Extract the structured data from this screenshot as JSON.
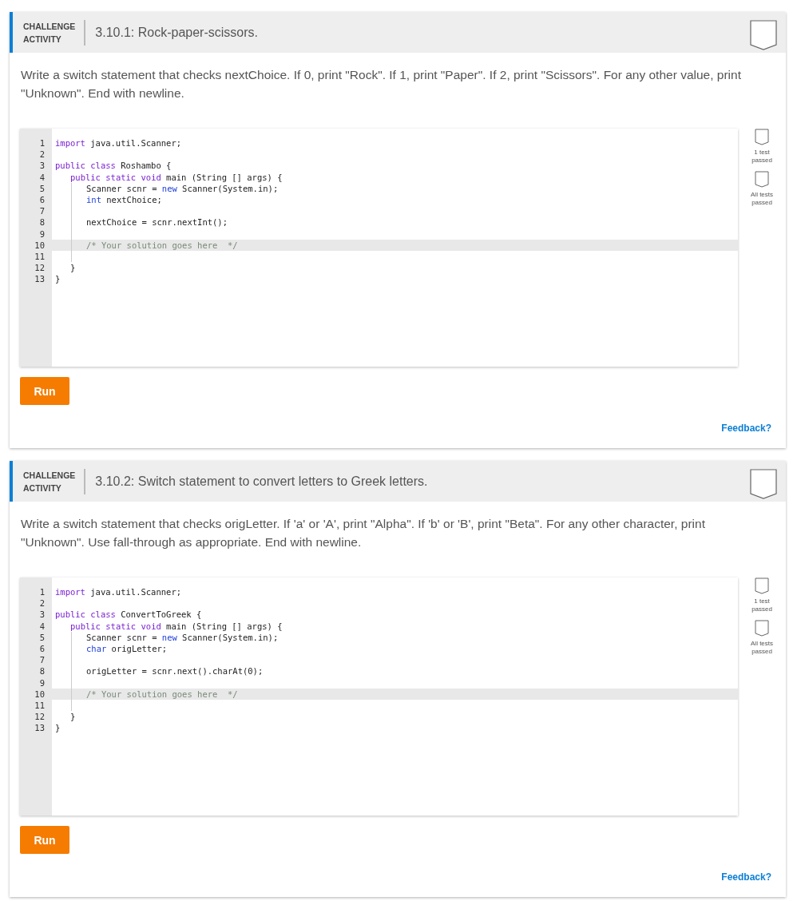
{
  "activities": [
    {
      "label_line1": "CHALLENGE",
      "label_line2": "ACTIVITY",
      "title": "3.10.1: Rock-paper-scissors.",
      "description": "Write a switch statement that checks nextChoice. If 0, print \"Rock\". If 1, print \"Paper\". If 2, print \"Scissors\". For any other value, print \"Unknown\". End with newline.",
      "code": [
        {
          "number": "1",
          "active": false,
          "tokens": [
            {
              "kind": "keyword",
              "text": "import"
            },
            {
              "kind": "plain",
              "text": " java.util.Scanner;"
            }
          ]
        },
        {
          "number": "2",
          "active": false
        },
        {
          "number": "3",
          "active": false,
          "tokens": [
            {
              "kind": "keyword",
              "text": "public class"
            },
            {
              "kind": "plain",
              "text": " Roshambo {"
            }
          ],
          "children": [
            {
              "number": "4",
              "active": false,
              "tokens": [
                {
                  "kind": "keyword",
                  "text": "public static void"
                },
                {
                  "kind": "plain",
                  "text": " main (String [] args) {"
                }
              ],
              "children": [
                {
                  "number": "5",
                  "active": false,
                  "tokens": [
                    {
                      "kind": "plain",
                      "text": "Scanner scnr = "
                    },
                    {
                      "kind": "type",
                      "text": "new"
                    },
                    {
                      "kind": "plain",
                      "text": " Scanner(System.in);"
                    }
                  ]
                },
                {
                  "number": "6",
                  "active": false,
                  "tokens": [
                    {
                      "kind": "type",
                      "text": "int"
                    },
                    {
                      "kind": "plain",
                      "text": " nextChoice;"
                    }
                  ]
                },
                {
                  "number": "7",
                  "active": false
                },
                {
                  "number": "8",
                  "active": false,
                  "tokens": [
                    {
                      "kind": "plain",
                      "text": "nextChoice = scnr.nextInt();"
                    }
                  ]
                },
                {
                  "number": "9",
                  "active": false
                },
                {
                  "number": "10",
                  "active": true,
                  "tokens": [
                    {
                      "kind": "comment",
                      "text": "/* Your solution goes here  */"
                    }
                  ]
                },
                {
                  "number": "11",
                  "active": false
                }
              ]
            },
            {
              "number": "12",
              "active": false,
              "tokens": [
                {
                  "kind": "plain",
                  "text": "}"
                }
              ]
            }
          ]
        },
        {
          "number": "13",
          "active": false,
          "tokens": [
            {
              "kind": "plain",
              "text": "}"
            }
          ]
        }
      ],
      "tests": [
        {
          "line1": "1 test",
          "line2": "passed"
        },
        {
          "line1": "All tests",
          "line2": "passed"
        }
      ],
      "run_button": "Run",
      "feedback": "Feedback?"
    },
    {
      "label_line1": "CHALLENGE",
      "label_line2": "ACTIVITY",
      "title": "3.10.2: Switch statement to convert letters to Greek letters.",
      "description": "Write a switch statement that checks origLetter. If 'a' or 'A', print \"Alpha\". If 'b' or 'B', print \"Beta\". For any other character, print \"Unknown\". Use fall-through as appropriate. End with newline.",
      "code": [
        {
          "number": "1",
          "active": false,
          "tokens": [
            {
              "kind": "keyword",
              "text": "import"
            },
            {
              "kind": "plain",
              "text": " java.util.Scanner;"
            }
          ]
        },
        {
          "number": "2",
          "active": false
        },
        {
          "number": "3",
          "active": false,
          "tokens": [
            {
              "kind": "keyword",
              "text": "public class"
            },
            {
              "kind": "plain",
              "text": " ConvertToGreek {"
            }
          ],
          "children": [
            {
              "number": "4",
              "active": false,
              "tokens": [
                {
                  "kind": "keyword",
                  "text": "public static void"
                },
                {
                  "kind": "plain",
                  "text": " main (String [] args) {"
                }
              ],
              "children": [
                {
                  "number": "5",
                  "active": false,
                  "tokens": [
                    {
                      "kind": "plain",
                      "text": "Scanner scnr = "
                    },
                    {
                      "kind": "type",
                      "text": "new"
                    },
                    {
                      "kind": "plain",
                      "text": " Scanner(System.in);"
                    }
                  ]
                },
                {
                  "number": "6",
                  "active": false,
                  "tokens": [
                    {
                      "kind": "type",
                      "text": "char"
                    },
                    {
                      "kind": "plain",
                      "text": " origLetter;"
                    }
                  ]
                },
                {
                  "number": "7",
                  "active": false
                },
                {
                  "number": "8",
                  "active": false,
                  "tokens": [
                    {
                      "kind": "plain",
                      "text": "origLetter = scnr.next().charAt(0);"
                    }
                  ]
                },
                {
                  "number": "9",
                  "active": false
                },
                {
                  "number": "10",
                  "active": true,
                  "tokens": [
                    {
                      "kind": "comment",
                      "text": "/* Your solution goes here  */"
                    }
                  ]
                },
                {
                  "number": "11",
                  "active": false
                }
              ]
            },
            {
              "number": "12",
              "active": false,
              "tokens": [
                {
                  "kind": "plain",
                  "text": "}"
                }
              ]
            }
          ]
        },
        {
          "number": "13",
          "active": false,
          "tokens": [
            {
              "kind": "plain",
              "text": "}"
            }
          ]
        }
      ],
      "tests": [
        {
          "line1": "1 test",
          "line2": "passed"
        },
        {
          "line1": "All tests",
          "line2": "passed"
        }
      ],
      "run_button": "Run",
      "feedback": "Feedback?"
    }
  ]
}
